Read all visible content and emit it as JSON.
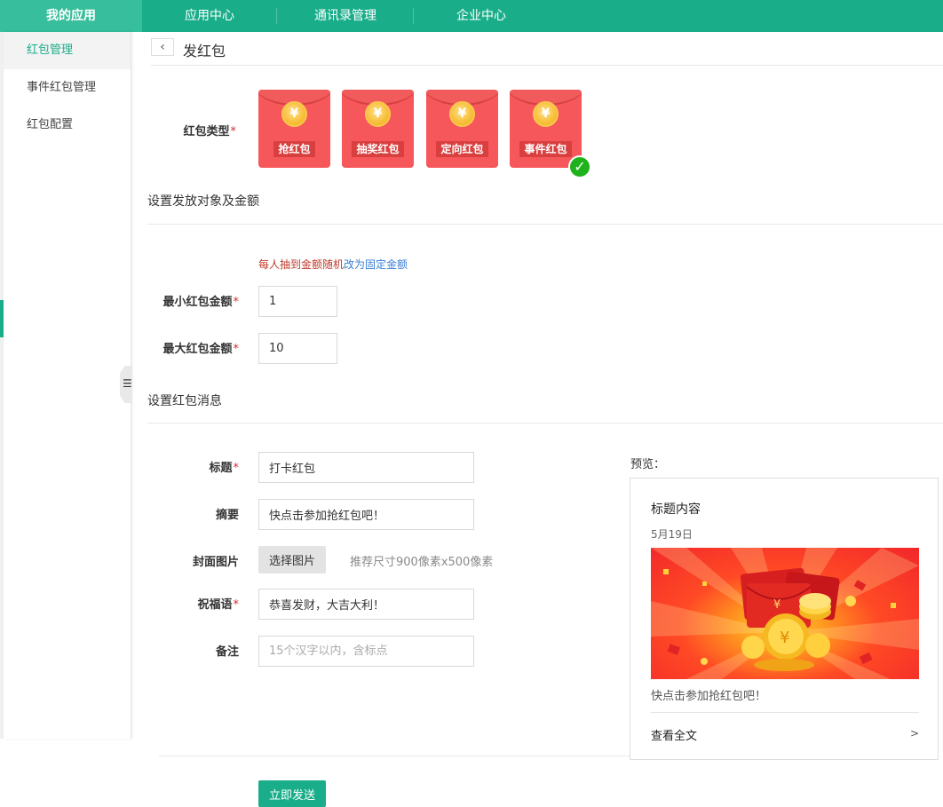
{
  "topnav": {
    "items": [
      {
        "label": "我的应用"
      },
      {
        "label": "应用中心"
      },
      {
        "label": "通讯录管理"
      },
      {
        "label": "企业中心"
      }
    ]
  },
  "sidebar": {
    "items": [
      {
        "label": "红包管理"
      },
      {
        "label": "事件红包管理"
      },
      {
        "label": "红包配置"
      }
    ]
  },
  "header": {
    "title": "发红包"
  },
  "form": {
    "type_label": "红包类型",
    "types": [
      {
        "label": "抢红包"
      },
      {
        "label": "抽奖红包"
      },
      {
        "label": "定向红包"
      },
      {
        "label": "事件红包"
      }
    ],
    "selected_type": "事件红包",
    "section_amount": "设置发放对象及金额",
    "random_hint": "每人抽到金额随机",
    "switch_link": "改为固定金额",
    "min_label": "最小红包金额",
    "min_value": "1",
    "max_label": "最大红包金额",
    "max_value": "10",
    "section_message": "设置红包消息",
    "title_label": "标题",
    "title_value": "打卡红包",
    "summary_label": "摘要",
    "summary_value": "快点击参加抢红包吧！",
    "cover_label": "封面图片",
    "cover_button": "选择图片",
    "cover_hint": "推荐尺寸900像素x500像素",
    "blessing_label": "祝福语",
    "blessing_value": "恭喜发财，大吉大利！",
    "note_label": "备注",
    "note_placeholder": "15个汉字以内，含标点",
    "submit_label": "立即发送"
  },
  "preview": {
    "label": "预览：",
    "title": "标题内容",
    "date": "5月19日",
    "summary": "快点击参加抢红包吧！",
    "more": "查看全文",
    "arrow": ">"
  },
  "colors": {
    "brand": "#1aad8a",
    "packet": "#f6575a",
    "required": "#d32f2f",
    "link": "#3a7fd5",
    "check": "#20b21c"
  },
  "icons": {
    "back": "chevron-left-icon",
    "collapse": "menu-icon",
    "coin": "yen-coin-icon",
    "selected": "check-icon"
  }
}
